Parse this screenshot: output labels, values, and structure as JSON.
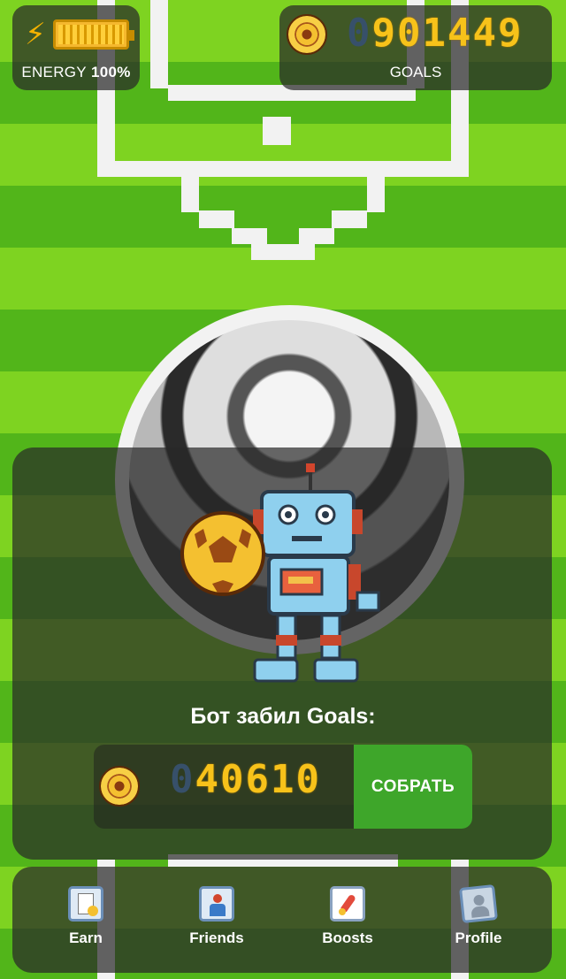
{
  "energy": {
    "label": "ENERGY",
    "value": "100%"
  },
  "goals": {
    "ghost_prefix": "0",
    "value": "901449",
    "label": "GOALS"
  },
  "bot": {
    "title": "Бот забил Goals:",
    "ghost_prefix": "0",
    "value": "40610",
    "collect_label": "СОБРАТЬ"
  },
  "nav": {
    "items": [
      {
        "label": "Earn",
        "icon": "earn-icon"
      },
      {
        "label": "Friends",
        "icon": "friends-icon"
      },
      {
        "label": "Boosts",
        "icon": "boosts-icon"
      },
      {
        "label": "Profile",
        "icon": "profile-icon"
      }
    ]
  },
  "colors": {
    "field_light": "#7ed321",
    "field_dark": "#52b51a",
    "accent_gold": "#f7c21a",
    "collect_green": "#3ea62a"
  }
}
